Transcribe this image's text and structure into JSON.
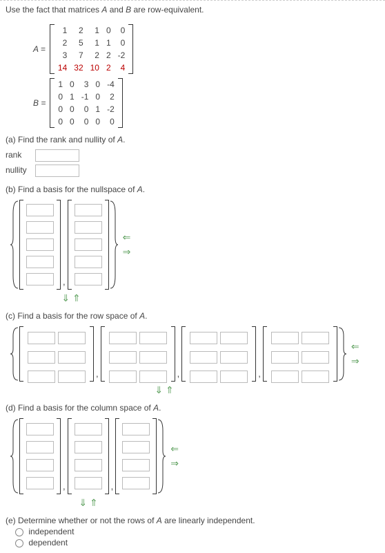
{
  "intro": {
    "pre": "Use the fact that matrices ",
    "A": "A",
    "mid": " and ",
    "B": "B",
    "post": " are row-equivalent."
  },
  "matA": {
    "lhs": "A =",
    "rows": [
      [
        "1",
        "2",
        "1",
        "0",
        "0"
      ],
      [
        "2",
        "5",
        "1",
        "1",
        "0"
      ],
      [
        "3",
        "7",
        "2",
        "2",
        "-2"
      ],
      [
        "14",
        "32",
        "10",
        "2",
        "4"
      ]
    ]
  },
  "matB": {
    "lhs": "B =",
    "rows": [
      [
        "1",
        "0",
        "3",
        "0",
        "-4"
      ],
      [
        "0",
        "1",
        "-1",
        "0",
        "2"
      ],
      [
        "0",
        "0",
        "0",
        "1",
        "-2"
      ],
      [
        "0",
        "0",
        "0",
        "0",
        "0"
      ]
    ]
  },
  "parts": {
    "a": {
      "prompt": "(a) Find the rank and nullity of ",
      "of": "A",
      "dot": ".",
      "rank": "rank",
      "nullity": "nullity"
    },
    "b": {
      "prompt": "(b) Find a basis for the nullspace of ",
      "of": "A",
      "dot": "."
    },
    "c": {
      "prompt": "(c) Find a basis for the row space of ",
      "of": "A",
      "dot": "."
    },
    "d": {
      "prompt": "(d) Find a basis for the column space of ",
      "of": "A",
      "dot": "."
    },
    "e": {
      "prompt": "(e) Determine whether or not the rows of ",
      "of": "A",
      "post": " are linearly independent.",
      "opt1": "independent",
      "opt2": "dependent"
    }
  },
  "glyphs": {
    "left": "⇐",
    "right": "⇒",
    "down": "⇓",
    "up": "⇑",
    "comma": ","
  }
}
